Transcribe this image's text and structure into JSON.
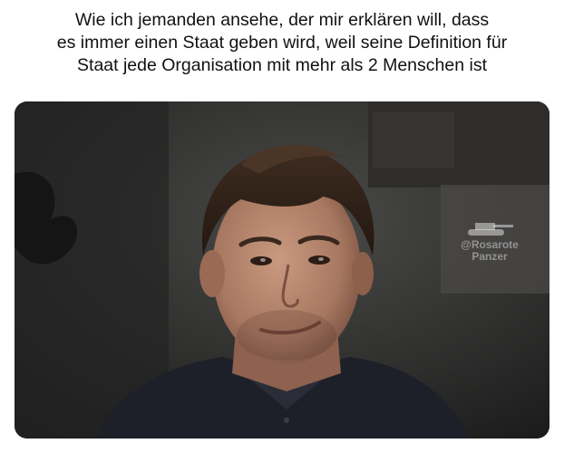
{
  "caption": {
    "lines": [
      "Wie ich jemanden ansehe, der mir erklären will, dass",
      "es immer einen Staat geben wird, weil seine Definition für",
      "Staat jede Organisation mit mehr als 2 Menschen ist"
    ]
  },
  "watermark": {
    "handle": "@Rosarote",
    "name": "Panzer",
    "icon": "tank-icon"
  },
  "photo": {
    "description_icon": "person-photo",
    "colors": {
      "background_dark": "#242424",
      "skin": "#b78b72",
      "hair": "#2c1f17",
      "shirt": "#1c1f2a"
    }
  }
}
